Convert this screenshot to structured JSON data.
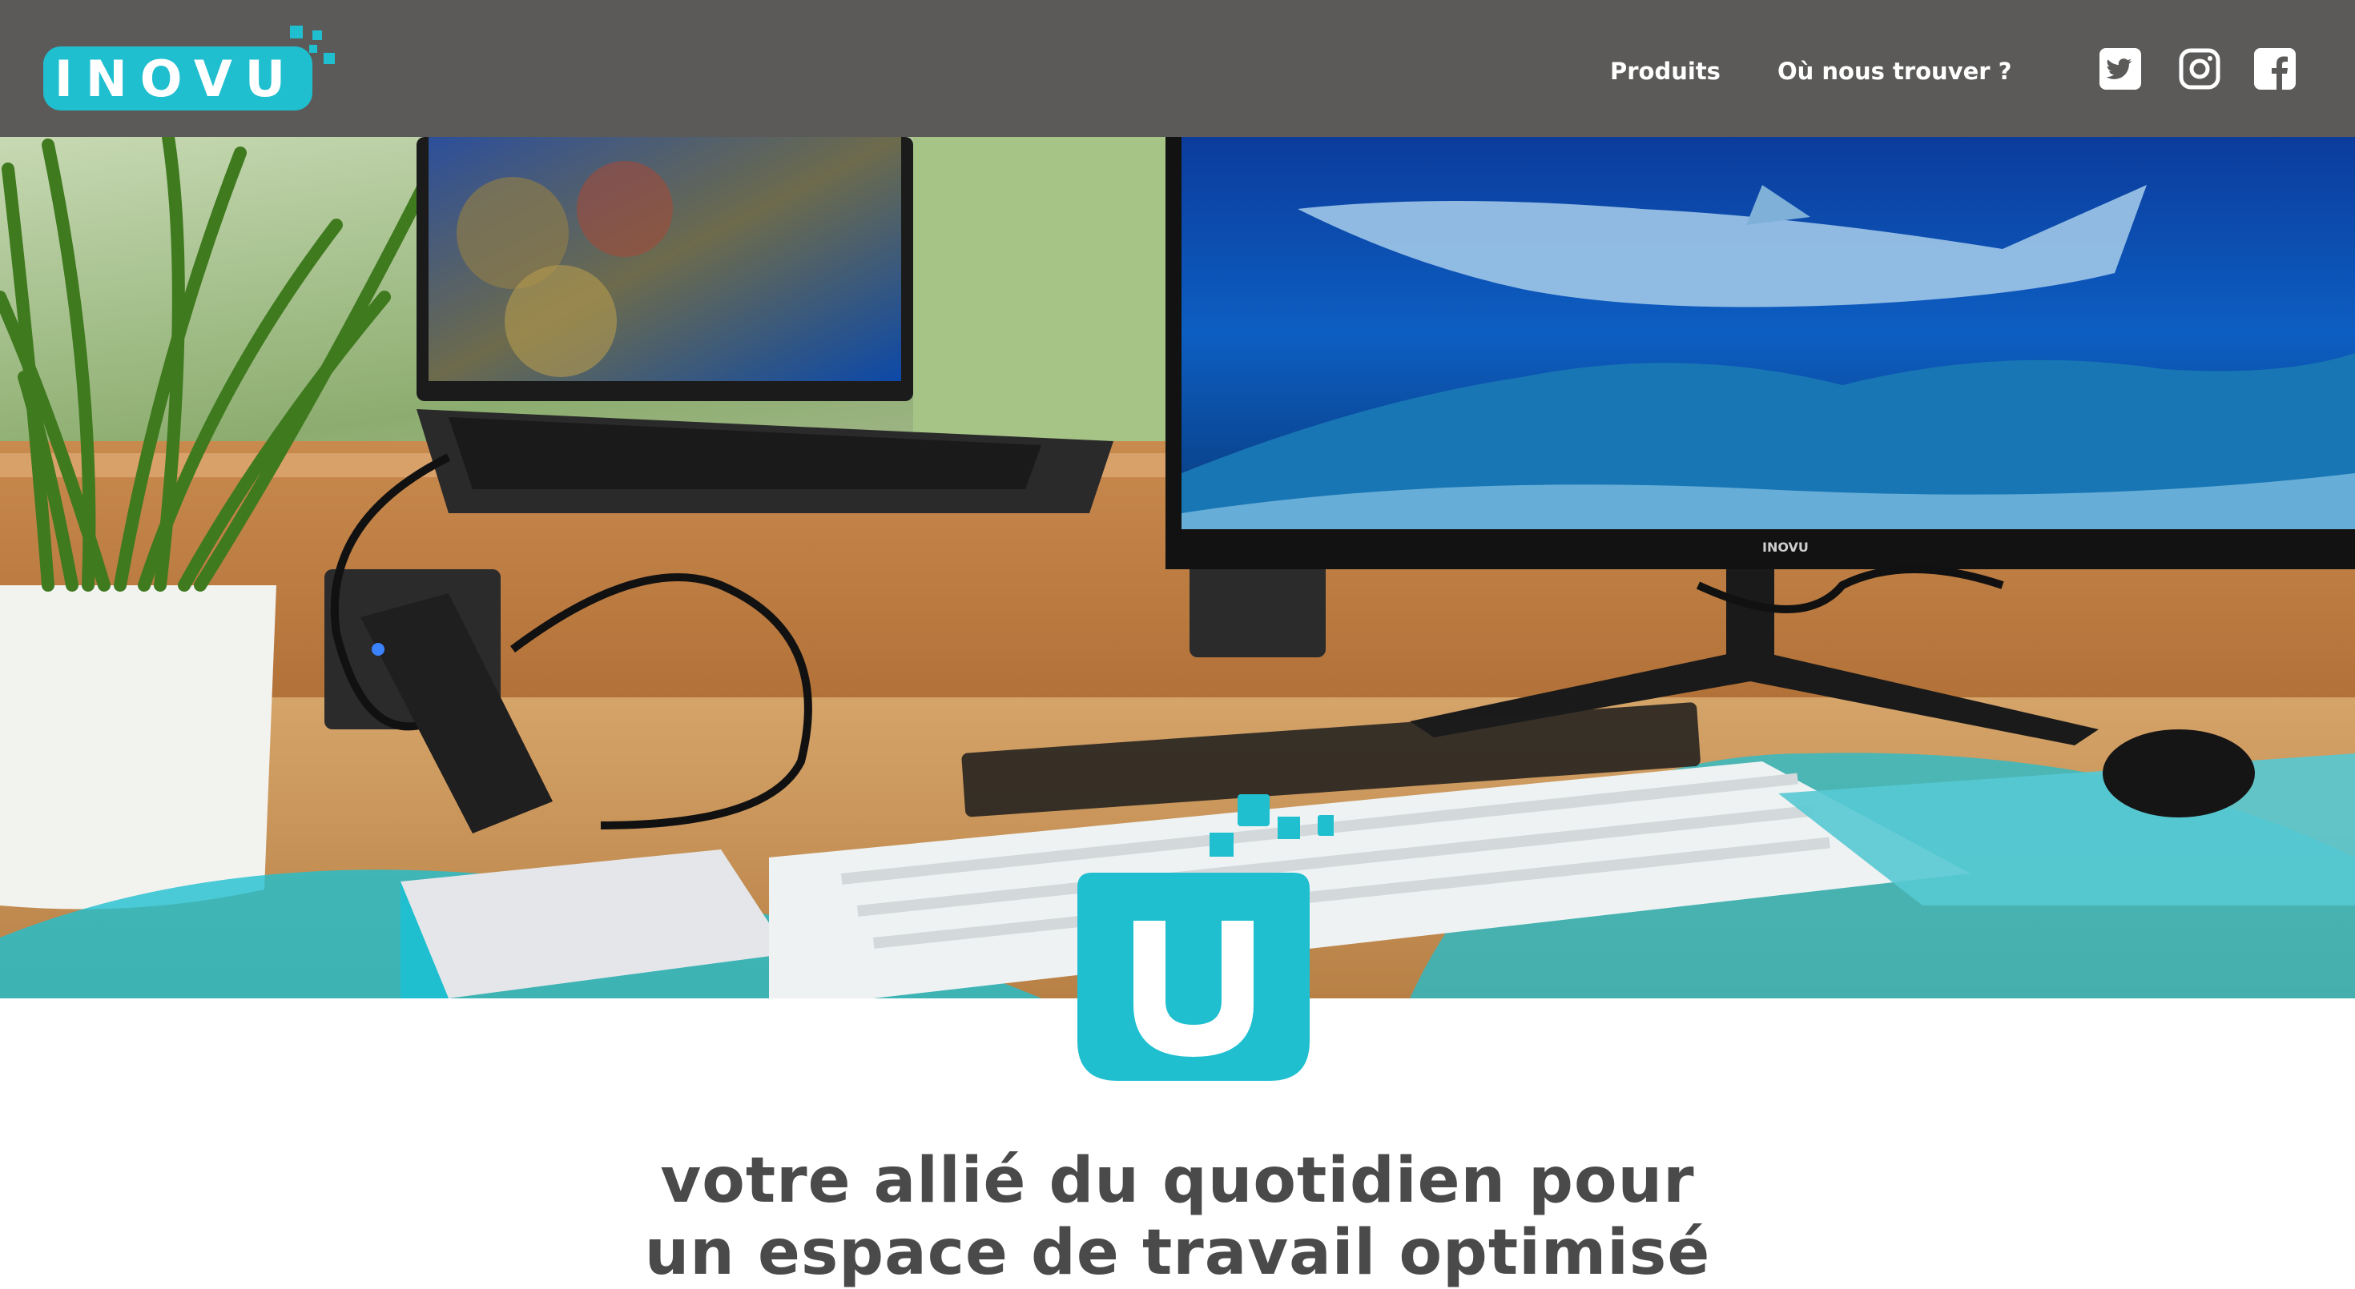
{
  "header": {
    "logo_text": "INOVU",
    "nav": [
      {
        "label": "Produits"
      },
      {
        "label": "Où nous trouver ?"
      }
    ],
    "social": [
      {
        "icon": "twitter-icon"
      },
      {
        "icon": "instagram-icon"
      },
      {
        "icon": "facebook-icon"
      }
    ]
  },
  "hero": {
    "monitor_brand": "INOVU"
  },
  "tagline": {
    "line1": "votre allié du quotidien pour",
    "line2": "un espace de travail optimisé"
  },
  "colors": {
    "header_bg": "#5b5a59",
    "accent": "#1fbfd0",
    "text": "#4a4a4a"
  }
}
